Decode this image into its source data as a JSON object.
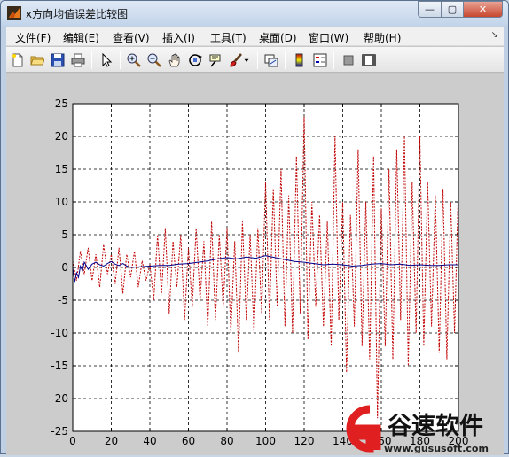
{
  "window": {
    "title": "x方向均值误差比较图",
    "controls": {
      "minimize": "—",
      "maximize": "▢",
      "close": "✕"
    }
  },
  "menu": {
    "items": [
      "文件(F)",
      "编辑(E)",
      "查看(V)",
      "插入(I)",
      "工具(T)",
      "桌面(D)",
      "窗口(W)",
      "帮助(H)"
    ],
    "dock": "↘"
  },
  "toolbar": {
    "buttons": [
      "new-figure",
      "open-file",
      "save",
      "print",
      "arrow-select",
      "zoom-in",
      "zoom-out",
      "pan",
      "rotate-3d",
      "data-cursor",
      "brush",
      "link-plot",
      "colorbar",
      "legend",
      "hide-plot-tools",
      "show-plot-tools"
    ]
  },
  "watermark": {
    "text": "谷速软件",
    "url": "www.gususoft.com"
  },
  "chart_data": {
    "type": "line",
    "xlim": [
      0,
      200
    ],
    "ylim": [
      -25,
      25
    ],
    "xticks": [
      0,
      20,
      40,
      60,
      80,
      100,
      120,
      140,
      160,
      180,
      200
    ],
    "xtick_labels": [
      "0",
      "20",
      "40",
      "60",
      "80",
      "100",
      "120",
      "140",
      "160",
      "180",
      "200"
    ],
    "yticks": [
      25,
      20,
      15,
      10,
      5,
      0,
      -5,
      -10,
      -15,
      -20,
      -25
    ],
    "ytick_labels": [
      "25",
      "20",
      "15",
      "10",
      "5",
      "0",
      "-5",
      "-10",
      "-15",
      "-20",
      "-25"
    ],
    "grid": true,
    "series": [
      {
        "color": "#c00000",
        "style": "dotted",
        "x": [
          0,
          2,
          4,
          6,
          8,
          10,
          12,
          14,
          16,
          18,
          20,
          22,
          24,
          26,
          28,
          30,
          32,
          34,
          36,
          38,
          40,
          42,
          44,
          46,
          48,
          50,
          52,
          54,
          56,
          58,
          60,
          62,
          64,
          66,
          68,
          70,
          72,
          74,
          76,
          78,
          80,
          82,
          84,
          86,
          88,
          90,
          92,
          94,
          96,
          98,
          100,
          102,
          104,
          106,
          108,
          110,
          112,
          114,
          116,
          118,
          120,
          122,
          124,
          126,
          128,
          130,
          132,
          134,
          136,
          138,
          140,
          142,
          144,
          146,
          148,
          150,
          152,
          154,
          156,
          158,
          160,
          162,
          164,
          166,
          168,
          170,
          172,
          174,
          176,
          178,
          180,
          182,
          184,
          186,
          188,
          190,
          192,
          194,
          196,
          198,
          200
        ],
        "values": [
          1,
          -2,
          2.5,
          -1,
          3,
          -2,
          2,
          -3,
          3.5,
          -1,
          2,
          -2.5,
          3,
          -4,
          2,
          -1.5,
          2.5,
          -3,
          1,
          -2,
          0.5,
          -5,
          5,
          -4,
          6,
          -7,
          4,
          -3,
          5,
          -8,
          3,
          -6,
          6,
          -5,
          4,
          -9,
          7,
          -8,
          5,
          -6,
          6,
          -10,
          4,
          -13,
          7,
          -8,
          5,
          -10,
          6,
          -7,
          13,
          -8,
          12,
          -6,
          15,
          -9,
          11,
          -10,
          17,
          -7,
          23,
          -11,
          10,
          -6,
          8,
          -9,
          7,
          -12,
          20,
          -8,
          10,
          -16,
          8,
          -9,
          18,
          -12,
          10,
          -14,
          17,
          -23,
          9,
          -12,
          15,
          -14,
          18,
          -8,
          20,
          -15,
          13,
          -10,
          20,
          -12,
          13,
          -9,
          11,
          -13,
          12,
          -14,
          10,
          -10,
          13
        ]
      },
      {
        "color": "#00008b",
        "style": "solid",
        "x": [
          0,
          1,
          2,
          3,
          4,
          5,
          6,
          7,
          8,
          10,
          12,
          14,
          16,
          18,
          20,
          22,
          24,
          26,
          28,
          30,
          35,
          40,
          45,
          50,
          55,
          60,
          65,
          70,
          75,
          80,
          85,
          90,
          95,
          100,
          105,
          110,
          115,
          120,
          125,
          130,
          135,
          140,
          145,
          150,
          155,
          160,
          165,
          170,
          175,
          180,
          185,
          190,
          195,
          200
        ],
        "values": [
          0,
          -2.2,
          -0.8,
          -1.5,
          0.2,
          -0.5,
          0.8,
          0.3,
          -0.3,
          0.5,
          0.8,
          0.4,
          0.2,
          0.6,
          0.9,
          0.5,
          0.3,
          0.6,
          0.2,
          0,
          0.1,
          0.2,
          0.3,
          0.3,
          0.5,
          0.6,
          0.8,
          1,
          1.3,
          1.5,
          1.3,
          1.6,
          1.4,
          1.8,
          1.5,
          1.2,
          0.9,
          0.8,
          0.6,
          0.4,
          0.5,
          0.4,
          0.2,
          0.3,
          0.5,
          0.6,
          0.4,
          0.5,
          0.3,
          0.4,
          0.3,
          0.3,
          0.4,
          0.4
        ]
      }
    ]
  }
}
